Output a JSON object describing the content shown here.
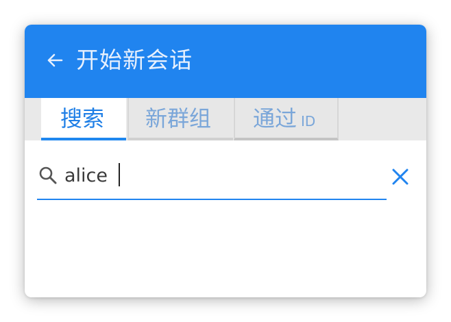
{
  "header": {
    "title": "开始新会话",
    "back_icon": "arrow-left-icon",
    "background_color": "#2084ef"
  },
  "tabs": [
    {
      "label": "搜索",
      "sub": "",
      "active": true
    },
    {
      "label": "新群组",
      "sub": "",
      "active": false
    },
    {
      "label": "通过",
      "sub": "ID",
      "active": false
    }
  ],
  "search": {
    "value": "alice",
    "placeholder": "",
    "search_icon": "search-icon",
    "clear_icon": "close-icon",
    "accent_color": "#2084ef"
  },
  "results": []
}
